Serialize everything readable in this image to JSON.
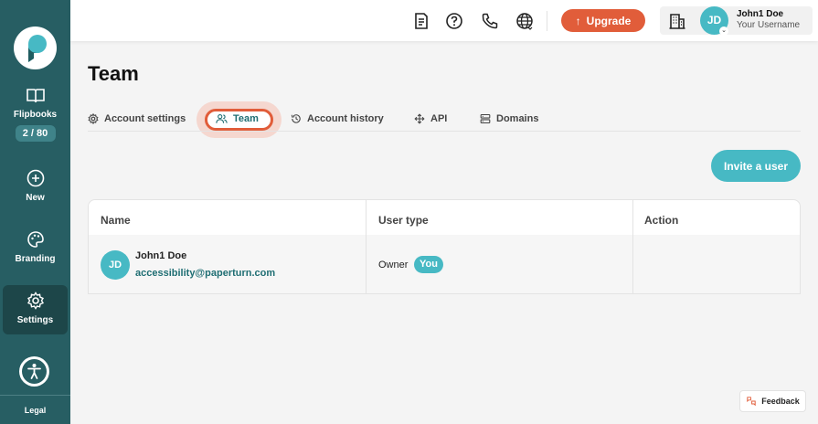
{
  "sidebar": {
    "items": [
      {
        "label": "Flipbooks",
        "counter": "2 / 80",
        "icon": "book-open-icon"
      },
      {
        "label": "New",
        "icon": "plus-circle-icon"
      },
      {
        "label": "Branding",
        "icon": "palette-icon"
      },
      {
        "label": "Settings",
        "icon": "gear-icon",
        "active": true
      }
    ],
    "legal": "Legal"
  },
  "topbar": {
    "upgrade_label": "Upgrade",
    "user_initials": "JD",
    "user_name": "John1 Doe",
    "user_sub": "Your Username"
  },
  "page": {
    "title": "Team",
    "tabs": [
      {
        "label": "Account settings",
        "icon": "gear-icon"
      },
      {
        "label": "Team",
        "icon": "users-icon",
        "active": true
      },
      {
        "label": "Account history",
        "icon": "history-icon"
      },
      {
        "label": "API",
        "icon": "move-icon"
      },
      {
        "label": "Domains",
        "icon": "server-icon"
      }
    ],
    "invite_label": "Invite a user"
  },
  "table": {
    "headers": [
      "Name",
      "User type",
      "Action"
    ],
    "rows": [
      {
        "initials": "JD",
        "name": "John1 Doe",
        "email": "accessibility@paperturn.com",
        "type": "Owner",
        "badge": "You"
      }
    ]
  },
  "feedback_label": "Feedback",
  "colors": {
    "sidebar": "#275e63",
    "accent": "#47b9c4",
    "upgrade": "#e15d3a"
  }
}
